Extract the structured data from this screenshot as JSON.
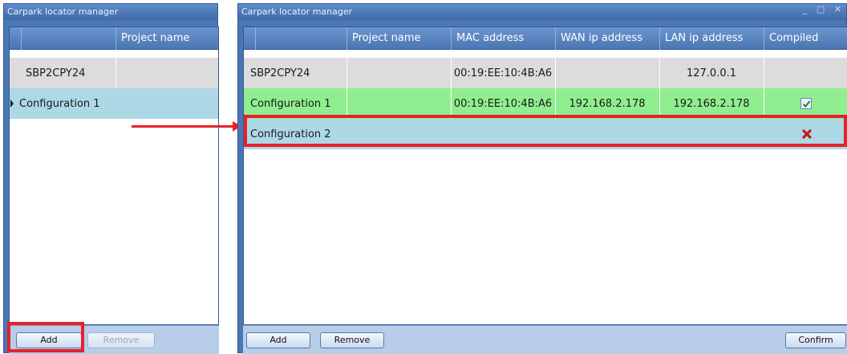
{
  "left_window": {
    "title": "Carpark locator manager",
    "column_header": "Project name",
    "rows": [
      {
        "name": "SBP2CPY24"
      },
      {
        "name": "Configuration 1"
      }
    ],
    "buttons": {
      "add": "Add",
      "remove": "Remove"
    }
  },
  "right_window": {
    "title": "Carpark locator manager",
    "columns": [
      "Project name",
      "MAC address",
      "WAN ip address",
      "LAN ip address",
      "Compiled"
    ],
    "rows": [
      {
        "name": "SBP2CPY24",
        "project": "",
        "mac": "00:19:EE:10:4B:A6",
        "wan": "",
        "lan": "127.0.0.1",
        "compiled": ""
      },
      {
        "name": "Configuration 1",
        "project": "",
        "mac": "00:19:EE:10:4B:A6",
        "wan": "192.168.2.178",
        "lan": "192.168.2.178",
        "compiled": "checked"
      },
      {
        "name": "Configuration 2",
        "project": "",
        "mac": "",
        "wan": "",
        "lan": "",
        "compiled": "not-compiled"
      }
    ],
    "buttons": {
      "add": "Add",
      "remove": "Remove",
      "confirm": "Confirm"
    }
  },
  "colors": {
    "window_blue": "#4a77b4",
    "row_gray": "#dcdcdc",
    "row_selected": "#add8e6",
    "row_green": "#90ee90",
    "highlight_red": "#e8202a"
  }
}
